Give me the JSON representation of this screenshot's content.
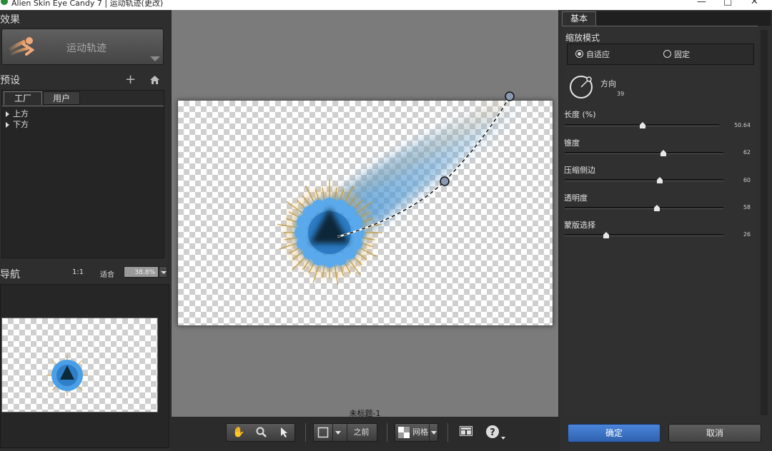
{
  "window": {
    "title": "Alien Skin Eye Candy 7 | 运动轨迹(更改)"
  },
  "left_panel": {
    "effects_title": "效果",
    "effect_name": "运动轨迹",
    "presets_title": "预设",
    "tabs": [
      "工厂",
      "用户"
    ],
    "preset_items": [
      "上方",
      "下方"
    ],
    "nav_title": "导航",
    "zoom_one_to_one": "1:1",
    "zoom_fit": "适合",
    "zoom_value": "38.8%"
  },
  "canvas": {
    "document_title": "未标题-1"
  },
  "toolbar": {
    "before_label": "之前",
    "grid_label": "网格"
  },
  "right_panel": {
    "tab": "基本",
    "scale_mode_label": "缩放模式",
    "scale_mode_options": [
      "自适应",
      "固定"
    ],
    "scale_mode_selected": "自适应",
    "direction_label": "方向",
    "direction_value": "39",
    "sliders": [
      {
        "label": "长度 (%)",
        "value": "50.64",
        "fraction": 0.506
      },
      {
        "label": "锥度",
        "value": "62",
        "fraction": 0.62
      },
      {
        "label": "压缩侧边",
        "value": "60",
        "fraction": 0.6
      },
      {
        "label": "透明度",
        "value": "58",
        "fraction": 0.58
      },
      {
        "label": "蒙版选择",
        "value": "26",
        "fraction": 0.26
      }
    ],
    "ok_label": "确定",
    "cancel_label": "取消"
  },
  "colors": {
    "ok_button": "#3a73c8",
    "canvas_bg": "#7b7b7b",
    "effect_blue": "#3d8fd6"
  }
}
